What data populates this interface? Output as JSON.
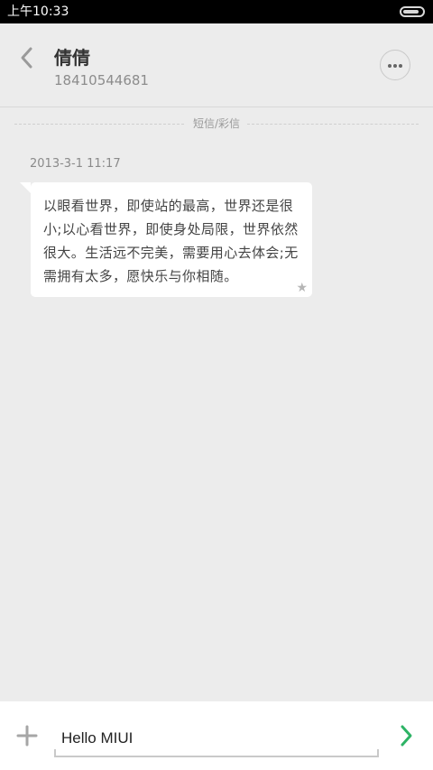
{
  "status_bar": {
    "time": "上午10:33",
    "battery_level": 0.85
  },
  "header": {
    "contact_name": "倩倩",
    "contact_number": "18410544681",
    "back_icon": "chevron-left-icon",
    "more_icon": "more-horizontal-icon"
  },
  "conversation": {
    "type_label": "短信/彩信",
    "messages": [
      {
        "time": "2013-3-1 11:17",
        "text": "以眼看世界，即使站的最高，世界还是很小;以心看世界，即使身处局限，世界依然很大。生活远不完美，需要用心去体会;无需拥有太多，愿快乐与你相随。",
        "starred": true
      }
    ]
  },
  "input_bar": {
    "value": "Hello MIUI",
    "add_icon": "plus-icon",
    "send_icon": "chevron-right-icon"
  },
  "colors": {
    "background": "#ececec",
    "status_bar": "#000000",
    "bubble": "#ffffff",
    "send_accent": "#2db365"
  }
}
